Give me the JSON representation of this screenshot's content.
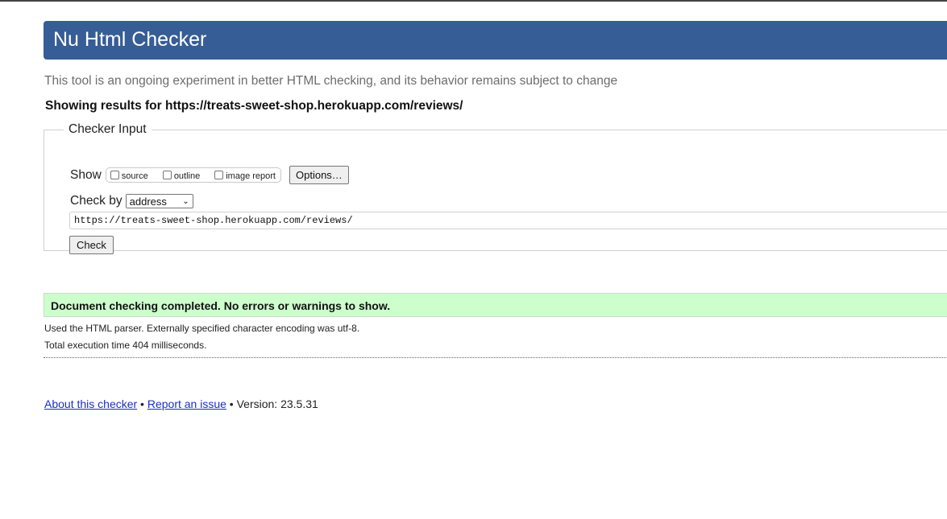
{
  "header": {
    "title": "Nu Html Checker"
  },
  "tagline": "This tool is an ongoing experiment in better HTML checking, and its behavior remains subject to change",
  "results_for": "Showing results for https://treats-sweet-shop.herokuapp.com/reviews/",
  "checker_input": {
    "legend": "Checker Input",
    "show_label": "Show",
    "show_options": [
      {
        "label": "source",
        "checked": false
      },
      {
        "label": "outline",
        "checked": false
      },
      {
        "label": "image report",
        "checked": false
      }
    ],
    "options_button": "Options…",
    "check_by_label": "Check by",
    "check_by_selected": "address",
    "url_value": "https://treats-sweet-shop.herokuapp.com/reviews/",
    "check_button": "Check"
  },
  "result": {
    "message": "Document checking completed. No errors or warnings to show.",
    "parser_info": "Used the HTML parser. Externally specified character encoding was utf-8.",
    "execution_time": "Total execution time 404 milliseconds."
  },
  "footer": {
    "about_link": "About this checker",
    "separator": " • ",
    "report_link": "Report an issue",
    "version": "Version: 23.5.31"
  },
  "colors": {
    "header_bg": "#365d95",
    "success_bg": "#ccffcc",
    "link": "#1a2fbe"
  }
}
